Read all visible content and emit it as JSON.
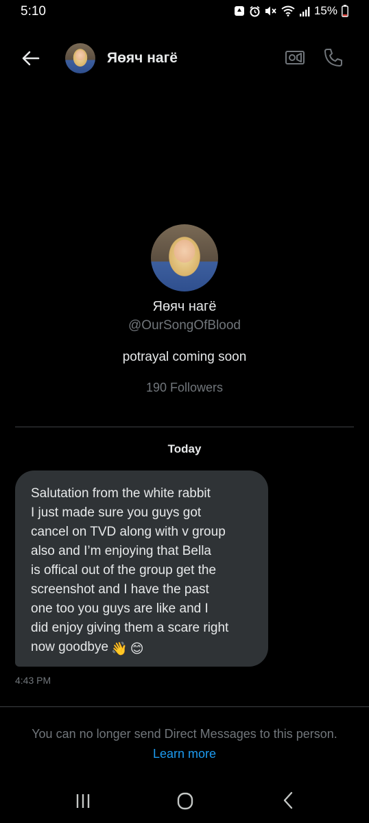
{
  "status_bar": {
    "time": "5:10",
    "battery": "15%",
    "icons": [
      "notification-icon",
      "alarm-icon",
      "mute-icon",
      "wifi-icon",
      "signal-icon",
      "battery-icon"
    ]
  },
  "header": {
    "title": "Яөяч нагё",
    "back_icon": "back-arrow-icon",
    "video_icon": "video-call-icon",
    "call_icon": "phone-icon"
  },
  "profile": {
    "name": "Яөяч нагё",
    "handle": "@OurSongOfBlood",
    "bio": "potrayal coming soon",
    "followers": "190 Followers"
  },
  "conversation": {
    "date_label": "Today",
    "messages": [
      {
        "text": "Salutation from the white rabbit\nI just made sure you guys got\ncancel on TVD along with v group\nalso and I’m enjoying that Bella\nis offical out of the group get the\nscreenshot and I have the past\none too you guys are like  and I\ndid enjoy giving them a scare right\nnow goodbye",
        "emojis": [
          "👋",
          "😊"
        ],
        "time": "4:43 PM"
      }
    ]
  },
  "footer": {
    "notice": "You can no longer send Direct Messages to this person.",
    "link_label": "Learn more"
  },
  "colors": {
    "background": "#000000",
    "bubble": "#2f3336",
    "text": "#e7e9ea",
    "muted": "#71767b",
    "link": "#1d9bf0",
    "divider": "#3e4144"
  },
  "nav_bar": {
    "icons": [
      "recents-icon",
      "home-icon",
      "nav-back-icon"
    ]
  }
}
